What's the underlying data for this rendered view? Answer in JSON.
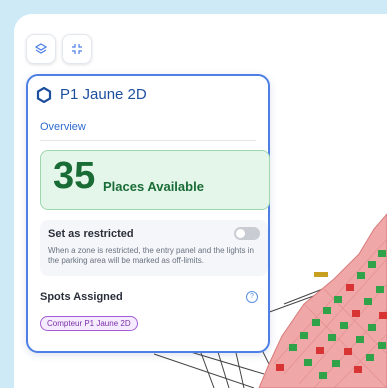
{
  "zone": {
    "name": "P1 Jaune 2D"
  },
  "tabs": {
    "overview": "Overview"
  },
  "availability": {
    "count": "35",
    "label": "Places Available"
  },
  "restricted": {
    "title": "Set as restricted",
    "description": "When a zone is restricted, the entry panel and the lights in the parking area will be marked as off-limits.",
    "enabled": false
  },
  "spots": {
    "title": "Spots Assigned",
    "chip": "Compteur P1 Jaune 2D"
  },
  "colors": {
    "accent": "#4e7fe6",
    "available_green": "#1a6c37",
    "map_zone": "#f0a7a7",
    "spot_green": "#2fa24a",
    "spot_red": "#d83434"
  },
  "icons": {
    "layers": "layers-icon",
    "collapse": "collapse-icon",
    "zone": "hexagon-icon",
    "help": "help-icon"
  }
}
